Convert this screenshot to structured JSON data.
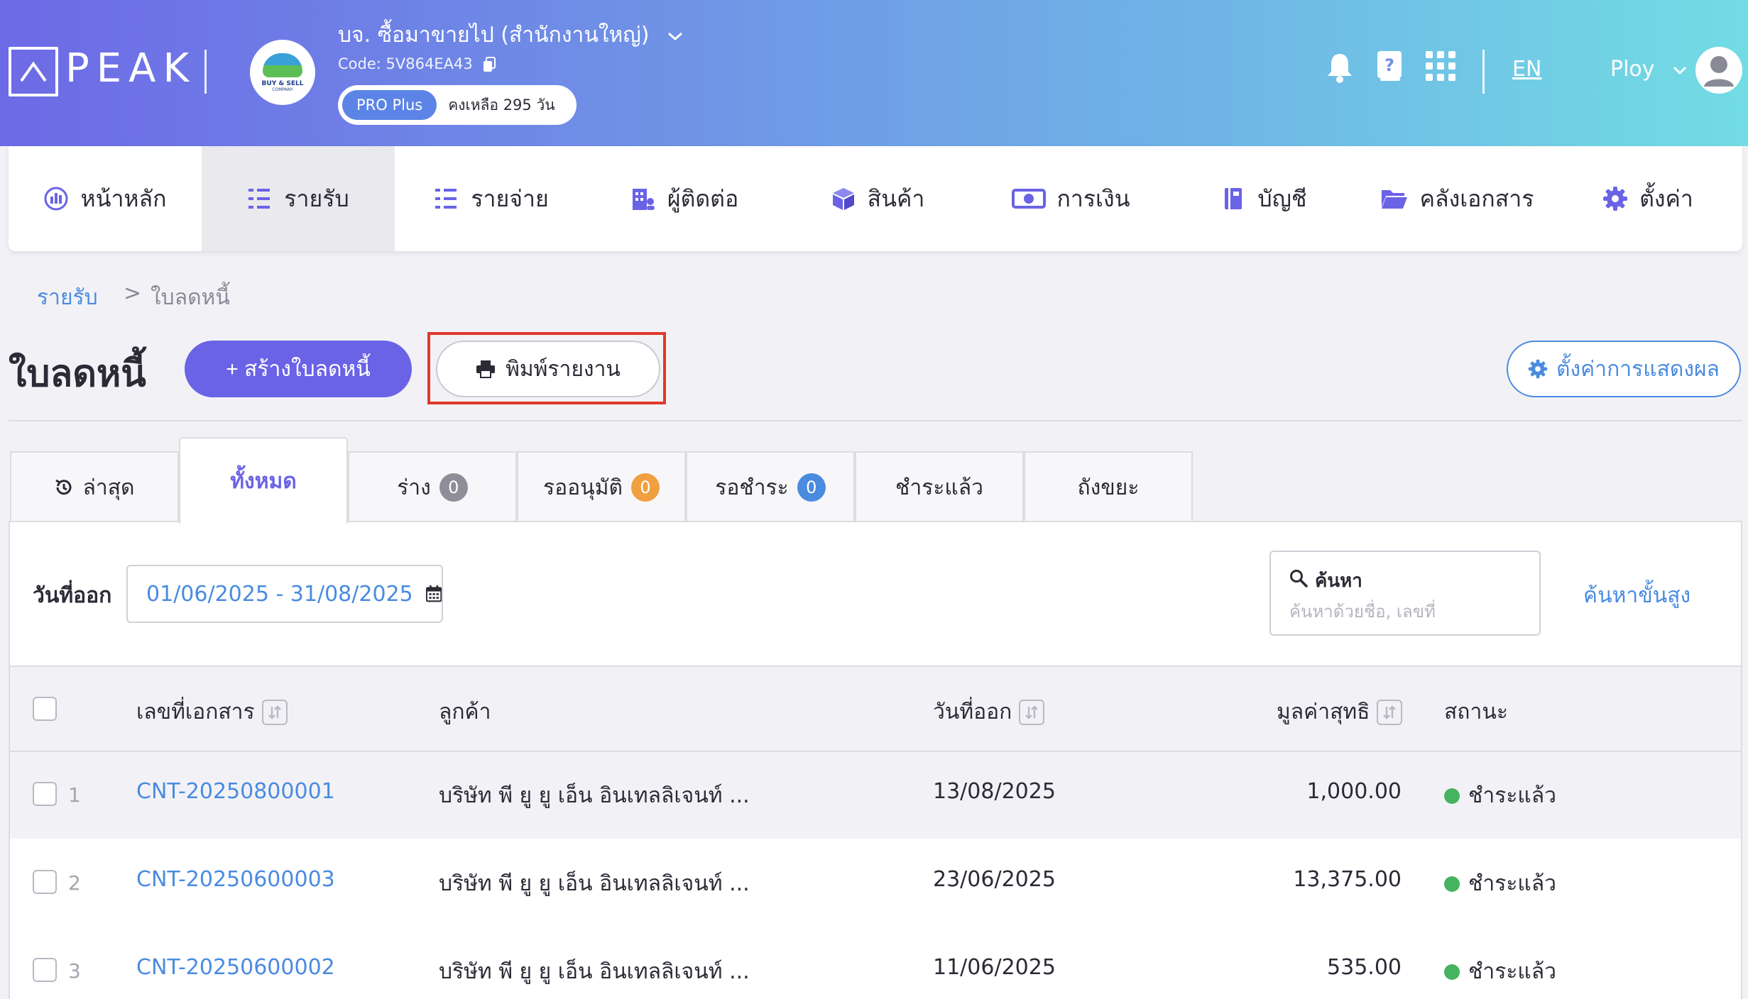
{
  "header": {
    "logo_text": "PEAK",
    "company_name": "บจ. ซื้อมาขายไป (สำนักงานใหญ่)",
    "company_code": "Code: 5V864EA43",
    "company_logo_text": "BUY & SELL",
    "company_logo_subtext": "COMPANY",
    "plan_name": "PRO Plus",
    "plan_remaining": "คงเหลือ 295 วัน",
    "language": "EN",
    "user_name": "Ploy"
  },
  "nav": {
    "items": [
      {
        "label": "หน้าหลัก",
        "icon": "dashboard-icon"
      },
      {
        "label": "รายรับ",
        "icon": "income-icon",
        "active": true
      },
      {
        "label": "รายจ่าย",
        "icon": "expense-icon"
      },
      {
        "label": "ผู้ติดต่อ",
        "icon": "contacts-icon"
      },
      {
        "label": "สินค้า",
        "icon": "product-box-icon"
      },
      {
        "label": "การเงิน",
        "icon": "money-icon"
      },
      {
        "label": "บัญชี",
        "icon": "accounting-book-icon"
      },
      {
        "label": "คลังเอกสาร",
        "icon": "folder-icon"
      },
      {
        "label": "ตั้งค่า",
        "icon": "gear-icon"
      }
    ]
  },
  "breadcrumb": {
    "parent": "รายรับ",
    "separator": ">",
    "current": "ใบลดหนี้"
  },
  "page": {
    "title": "ใบลดหนี้",
    "create_button": "+ สร้างใบลดหนี้",
    "print_button": "พิมพ์รายงาน",
    "display_settings_button": "ตั้งค่าการแสดงผล"
  },
  "tabs": [
    {
      "label": "ล่าสุด",
      "icon": "history-icon"
    },
    {
      "label": "ทั้งหมด",
      "active": true
    },
    {
      "label": "ร่าง",
      "count": "0",
      "count_color": "#8e8e99"
    },
    {
      "label": "รออนุมัติ",
      "count": "0",
      "count_color": "#f0a040"
    },
    {
      "label": "รอชำระ",
      "count": "0",
      "count_color": "#4a8be0"
    },
    {
      "label": "ชำระแล้ว"
    },
    {
      "label": "ถังขยะ"
    }
  ],
  "filter": {
    "date_label": "วันที่ออก",
    "date_range": "01/06/2025 - 31/08/2025",
    "search_label": "ค้นหา",
    "search_placeholder": "ค้นหาด้วยชื่อ, เลขที่",
    "advanced_search": "ค้นหาขั้นสูง"
  },
  "table": {
    "columns": {
      "doc_no": "เลขที่เอกสาร",
      "customer": "ลูกค้า",
      "issue_date": "วันที่ออก",
      "net_amount": "มูลค่าสุทธิ",
      "status": "สถานะ"
    },
    "rows": [
      {
        "num": "1",
        "doc_no": "CNT-20250800001",
        "customer": "บริษัท พี ยู ยู เอ็น อินเทลลิเจนท์ ...",
        "issue_date": "13/08/2025",
        "net_amount": "1,000.00",
        "status": "ชำระแล้ว"
      },
      {
        "num": "2",
        "doc_no": "CNT-20250600003",
        "customer": "บริษัท พี ยู ยู เอ็น อินเทลลิเจนท์ ...",
        "issue_date": "23/06/2025",
        "net_amount": "13,375.00",
        "status": "ชำระแล้ว"
      },
      {
        "num": "3",
        "doc_no": "CNT-20250600002",
        "customer": "บริษัท พี ยู ยู เอ็น อินเทลลิเจนท์ ...",
        "issue_date": "11/06/2025",
        "net_amount": "535.00",
        "status": "ชำระแล้ว"
      }
    ]
  },
  "colors": {
    "primary": "#6a63e6",
    "link": "#4a8be0",
    "paid_status": "#46b35f",
    "highlight": "#e0392b"
  }
}
